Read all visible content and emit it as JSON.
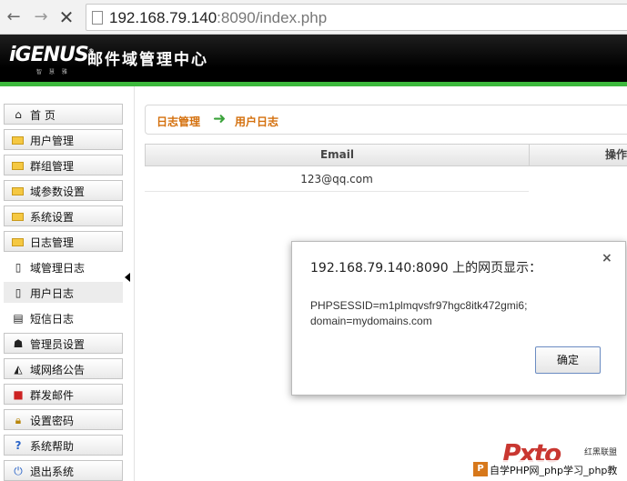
{
  "browser": {
    "url_host": "192.168.79.140",
    "url_rest": ":8090/index.php"
  },
  "header": {
    "logo_text": "iGENUS",
    "logo_sub": "智 慧 雅",
    "title": "邮件域管理中心",
    "accent_color": "#3cb83c"
  },
  "sidebar": {
    "items": [
      {
        "label": "首 页",
        "icon": "home-icon"
      },
      {
        "label": "用户管理",
        "icon": "folder-icon"
      },
      {
        "label": "群组管理",
        "icon": "folder-icon"
      },
      {
        "label": "域参数设置",
        "icon": "folder-icon"
      },
      {
        "label": "系统设置",
        "icon": "folder-icon"
      },
      {
        "label": "日志管理",
        "icon": "folder-icon"
      },
      {
        "label": "域管理日志",
        "icon": "document-icon"
      },
      {
        "label": "用户日志",
        "icon": "document-icon"
      },
      {
        "label": "短信日志",
        "icon": "document-icon"
      },
      {
        "label": "管理员设置",
        "icon": "admin-icon"
      },
      {
        "label": "域网络公告",
        "icon": "megaphone-icon"
      },
      {
        "label": "群发邮件",
        "icon": "mail-icon"
      },
      {
        "label": "设置密码",
        "icon": "lock-icon"
      },
      {
        "label": "系统帮助",
        "icon": "help-icon"
      },
      {
        "label": "退出系统",
        "icon": "power-icon"
      }
    ]
  },
  "breadcrumb": {
    "parent": "日志管理",
    "current": "用户日志"
  },
  "table": {
    "columns": [
      "Email",
      "操作"
    ],
    "rows": [
      {
        "email": "123@qq.com"
      }
    ]
  },
  "dialog": {
    "title": "192.168.79.140:8090 上的网页显示：",
    "message": "PHPSESSID=m1plmqvsfr97hgc8itk472gmi6; domain=mydomains.com",
    "ok_label": "确定",
    "close_glyph": "×"
  },
  "watermark": {
    "logo": "Pxto",
    "sub": "红黑联盟",
    "badge": "P",
    "text": "自学PHP网_php学习_php教"
  }
}
